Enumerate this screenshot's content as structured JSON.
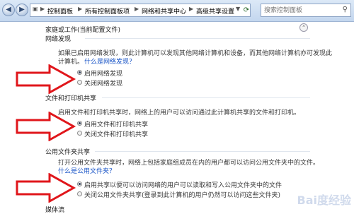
{
  "address_bar": {
    "crumbs": [
      "控制面板",
      "所有控制面板项",
      "网络和共享中心",
      "高级共享设置"
    ],
    "search_placeholder": "搜索控制面板"
  },
  "profile_title": "家庭或工作(当前配置文件)",
  "sections": [
    {
      "title": "网络发现",
      "desc_line1": "如果已启用网络发现，则此计算机可以发现其他网络计算机和设备，而其他网络计算机亦可发现此",
      "desc_line2": "计算机。",
      "link": "什么是网络发现？",
      "options": [
        "启用网络发现",
        "关闭网络发现"
      ],
      "selected_index": 0
    },
    {
      "title": "文件和打印机共享",
      "desc_line1": "启用文件和打印机共享时，网络上的用户可以访问通过此计算机共享的文件和打印机。",
      "options": [
        "启用文件和打印机共享",
        "关闭文件和打印机共享"
      ],
      "selected_index": 0
    },
    {
      "title": "公用文件夹共享",
      "desc_line1": "打开公用文件夹共享时，网络上包括家庭组成员在内的用户都可以访问公用文件夹中的文件。",
      "link": "什么是公用文件夹？",
      "options": [
        "启用共享以便可以访问网络的用户可以读取和写入公用文件夹中的文件",
        "关闭公用文件夹共享(登录到此计算机的用户仍然可以访问这些文件夹)"
      ],
      "selected_index": 0
    }
  ],
  "next_section_title": "媒体流",
  "watermark": "Bai度经验",
  "colors": {
    "arrow": "#e0161b",
    "link": "#1a55c7"
  }
}
